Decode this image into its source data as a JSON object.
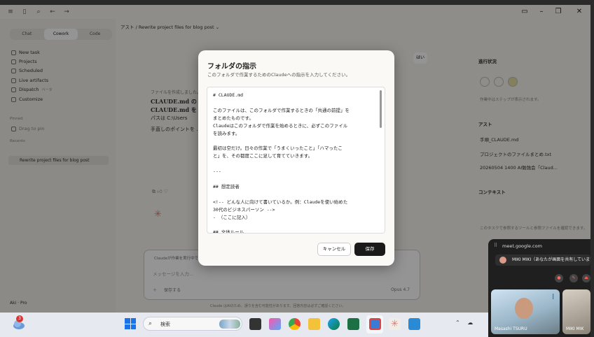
{
  "app": {
    "modes": [
      "Chat",
      "Cowork",
      "Code"
    ],
    "active_mode": "Cowork",
    "nav": [
      "New task",
      "Projects",
      "Scheduled",
      "Live artifacts",
      "Dispatch",
      "Customize"
    ],
    "dispatch_badge": "ベータ",
    "section_pinned": "Pinned",
    "pinned_item": "Drag to pin",
    "section_recents": "Recents",
    "recent_item": "Rewrite project files for blog post",
    "user": "Aki",
    "user_plan": "Pro",
    "breadcrumb_project": "アスト",
    "breadcrumb_sep": "/",
    "breadcrumb_title": "Rewrite project files for blog post",
    "top_right_button": "はい",
    "main_line1": "ファイルを作成しました。",
    "main_line2": "CLAUDE.md の",
    "main_line3": "CLAUDE.md を",
    "main_line4": "パスは C:\\Users",
    "main_para": "手直しのポイントを ... \"NG\" ... スト」の全項目を ... に埋め ... す。作業しながら ... しています。",
    "composer_note": "Claudeが作業を実行中です",
    "composer_placeholder": "メッセージを入力...",
    "composer_model": "Opus 4.7",
    "composer_tool": "保存する",
    "footer_note": "Claude はAIのため、誤りを含む可能性があります。回答内容は必ずご確認ください。"
  },
  "right_panel": {
    "progress_title": "進行状況",
    "progress_caption": "作業中はステップが表示されます。",
    "context_title": "アスト",
    "files": [
      "手順_CLAUDE.md",
      "プロジェクトのファイルまとめ.txt",
      "20260504 1400 AI勉強会「Claud..."
    ],
    "ctx_title": "コンテキスト",
    "ctx_caption": "このタスクで参照するツールと参照ファイルを確認できます。"
  },
  "modal": {
    "title": "フォルダの指示",
    "subtitle": "このフォルダで作業するためのClaudeへの指示を入力してください。",
    "content": "# CLAUDE.md\n\nこのファイルは、このフォルダで作業するときの「共通の前提」を\nまとめたものです。\nClaudeはこのフォルダで作業を始めるときに、必ずこのファイル\nを読みます。\n\n最初は空だけ。日々の作業で「うまくいったこと」「ハマったこ\nと」を、その都度ここに足して育てていきます。\n\n---\n\n## 想定読者\n\n<!-- どんな人に向けて書いているか。例：Claudeを使い始めた\n30代のビジネスパーソン -->\n- （ここに記入）\n\n## 文体ルール",
    "cancel": "キャンセル",
    "save": "保存"
  },
  "meet": {
    "url": "meet.google.com",
    "presenting": "MIKI MIKI（あなたが画面を共有しています）",
    "participants": [
      "Masashi TSURU",
      "MIKI MIK"
    ]
  },
  "taskbar": {
    "weather_badge": "3",
    "search_label": "検索"
  }
}
